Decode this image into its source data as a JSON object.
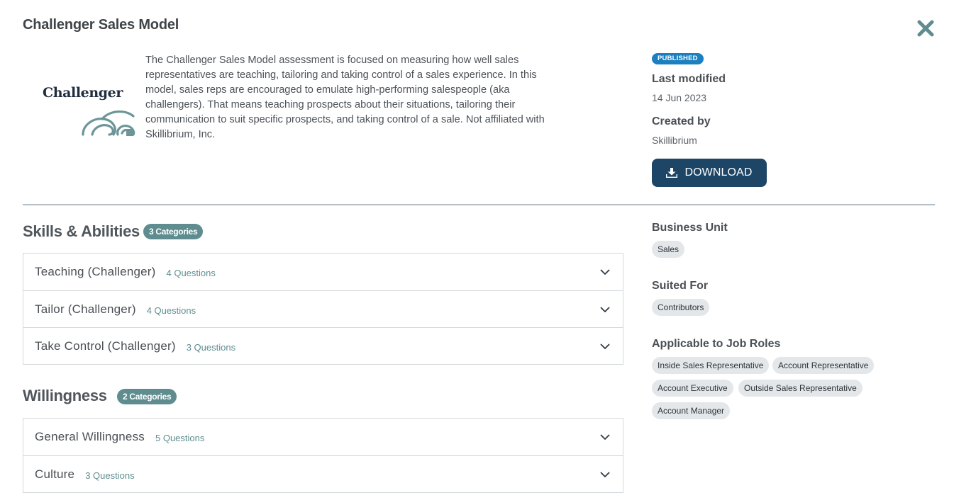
{
  "header": {
    "title": "Challenger Sales Model"
  },
  "logo": {
    "wordmark": "Challenger"
  },
  "description": "The Challenger Sales Model assessment is focused on measuring how well sales representatives are teaching, tailoring and taking control of a sales experience. In this model, sales reps are encouraged to emulate high-performing salespeople (aka challengers). That means teaching prospects about their situations, tailoring their communication to suit specific prospects, and taking control of a sale. Not affiliated with Skillibrium, Inc.",
  "meta": {
    "status": "PUBLISHED",
    "last_modified_label": "Last modified",
    "last_modified_value": "14 Jun 2023",
    "created_by_label": "Created by",
    "created_by_value": "Skillibrium",
    "download_label": "DOWNLOAD"
  },
  "sections": [
    {
      "title": "Skills & Abilities",
      "badge": "3 Categories",
      "items": [
        {
          "name": "Teaching (Challenger)",
          "questions": "4 Questions"
        },
        {
          "name": "Tailor (Challenger)",
          "questions": "4 Questions"
        },
        {
          "name": "Take Control (Challenger)",
          "questions": "3 Questions"
        }
      ]
    },
    {
      "title": "Willingness",
      "badge": "2 Categories",
      "items": [
        {
          "name": "General Willingness",
          "questions": "5 Questions"
        },
        {
          "name": "Culture",
          "questions": "3 Questions"
        }
      ]
    }
  ],
  "sidebar": {
    "business_unit_label": "Business Unit",
    "business_unit_tags": [
      "Sales"
    ],
    "suited_for_label": "Suited For",
    "suited_for_tags": [
      "Contributors"
    ],
    "job_roles_label": "Applicable to Job Roles",
    "job_roles_tags": [
      "Inside Sales Representative",
      "Account Representative",
      "Account Executive",
      "Outside Sales Representative",
      "Account Manager"
    ]
  },
  "colors": {
    "primary_button": "#1c4566",
    "status_badge": "#1b7fc0",
    "category_badge": "#5f8d8f",
    "close_icon": "#5f8d8f",
    "tag_bg": "#e3e7ea"
  },
  "icons": {
    "close": "close-icon",
    "download": "download-icon",
    "chevron": "chevron-down-icon"
  }
}
